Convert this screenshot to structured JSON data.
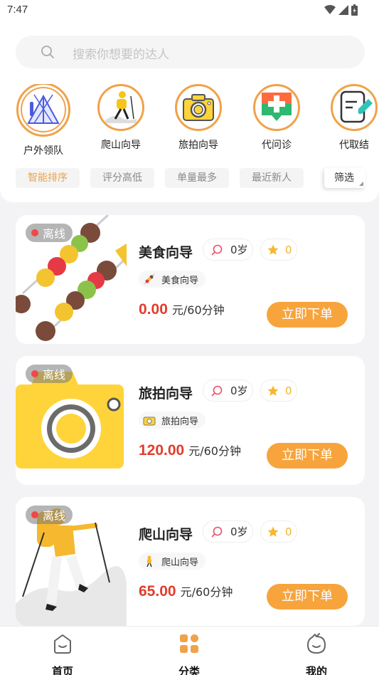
{
  "status_bar": {
    "time": "7:47"
  },
  "search": {
    "placeholder": "搜索你想要的达人"
  },
  "categories": [
    {
      "label": "户外领队",
      "icon": "tent-icon"
    },
    {
      "label": "爬山向导",
      "icon": "hiker-icon"
    },
    {
      "label": "旅拍向导",
      "icon": "camera-icon"
    },
    {
      "label": "代问诊",
      "icon": "medical-icon"
    },
    {
      "label": "代取结",
      "icon": "report-icon"
    }
  ],
  "sort_options": [
    "智能排序",
    "评分高低",
    "单量最多",
    "最近新人"
  ],
  "filter_label": "筛选",
  "cards": [
    {
      "status": "离线",
      "title": "美食向导",
      "age": "0岁",
      "rating": "0",
      "tag": "美食向导",
      "price": "0.00",
      "unit": "元/60分钟",
      "button": "立即下单",
      "image": "skewer-illustration"
    },
    {
      "status": "离线",
      "title": "旅拍向导",
      "age": "0岁",
      "rating": "0",
      "tag": "旅拍向导",
      "price": "120.00",
      "unit": "元/60分钟",
      "button": "立即下单",
      "image": "camera-illustration"
    },
    {
      "status": "离线",
      "title": "爬山向导",
      "age": "0岁",
      "rating": "0",
      "tag": "爬山向导",
      "price": "65.00",
      "unit": "元/60分钟",
      "button": "立即下单",
      "image": "hiker-illustration"
    }
  ],
  "bottom_nav": [
    {
      "label": "首页",
      "icon": "home-icon"
    },
    {
      "label": "分类",
      "icon": "category-icon",
      "active": true
    },
    {
      "label": "我的",
      "icon": "profile-icon"
    }
  ],
  "colors": {
    "accent": "#f7a43d",
    "price": "#e23c2c",
    "offline_dot": "#f04848",
    "nav_active": "#f0a24a"
  }
}
